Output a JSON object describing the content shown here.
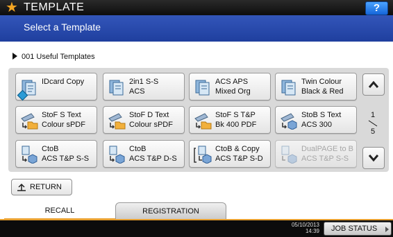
{
  "header": {
    "title": "TEMPLATE",
    "subtitle": "Select a Template",
    "help_label": "?",
    "accent_color": "#2d4fb2"
  },
  "section": {
    "label": "001  Useful Templates"
  },
  "templates": [
    {
      "line1": "IDcard Copy",
      "line2": "",
      "icon": "copy-doc-icon",
      "selected_mark": true,
      "disabled": false
    },
    {
      "line1": "2in1 S-S",
      "line2": "ACS",
      "icon": "copy-doc-icon",
      "disabled": false
    },
    {
      "line1": "ACS APS",
      "line2": "Mixed Org",
      "icon": "copy-doc-icon",
      "disabled": false
    },
    {
      "line1": "Twin Colour",
      "line2": "Black & Red",
      "icon": "copy-doc-icon",
      "disabled": false
    },
    {
      "line1": "StoF S Text",
      "line2": "Colour sPDF",
      "icon": "scan-to-folder-icon",
      "disabled": false
    },
    {
      "line1": "StoF D Text",
      "line2": "Colour sPDF",
      "icon": "scan-to-folder-icon",
      "disabled": false
    },
    {
      "line1": "StoF S T&P",
      "line2": "Bk 400 PDF",
      "icon": "scan-to-folder-icon",
      "disabled": false
    },
    {
      "line1": "StoB S Text",
      "line2": "ACS 300",
      "icon": "scan-to-box-icon",
      "disabled": false
    },
    {
      "line1": "CtoB",
      "line2": "ACS T&P S-S",
      "icon": "copy-to-box-icon",
      "disabled": false
    },
    {
      "line1": "CtoB",
      "line2": "ACS T&P D-S",
      "icon": "copy-to-box-icon",
      "disabled": false
    },
    {
      "line1": "CtoB & Copy",
      "line2": "ACS T&P S-D",
      "icon": "copy-to-box-and-copy-icon",
      "disabled": false
    },
    {
      "line1": "DualPAGE to B",
      "line2": "ACS T&P S-S",
      "icon": "copy-to-box-icon",
      "disabled": true
    }
  ],
  "pager": {
    "current": "1",
    "total": "5"
  },
  "return_label": "RETURN",
  "tabs": {
    "recall": "RECALL",
    "registration": "REGISTRATION"
  },
  "footer": {
    "date": "05/10/2013",
    "time": "14:39",
    "job_status": "JOB STATUS"
  }
}
